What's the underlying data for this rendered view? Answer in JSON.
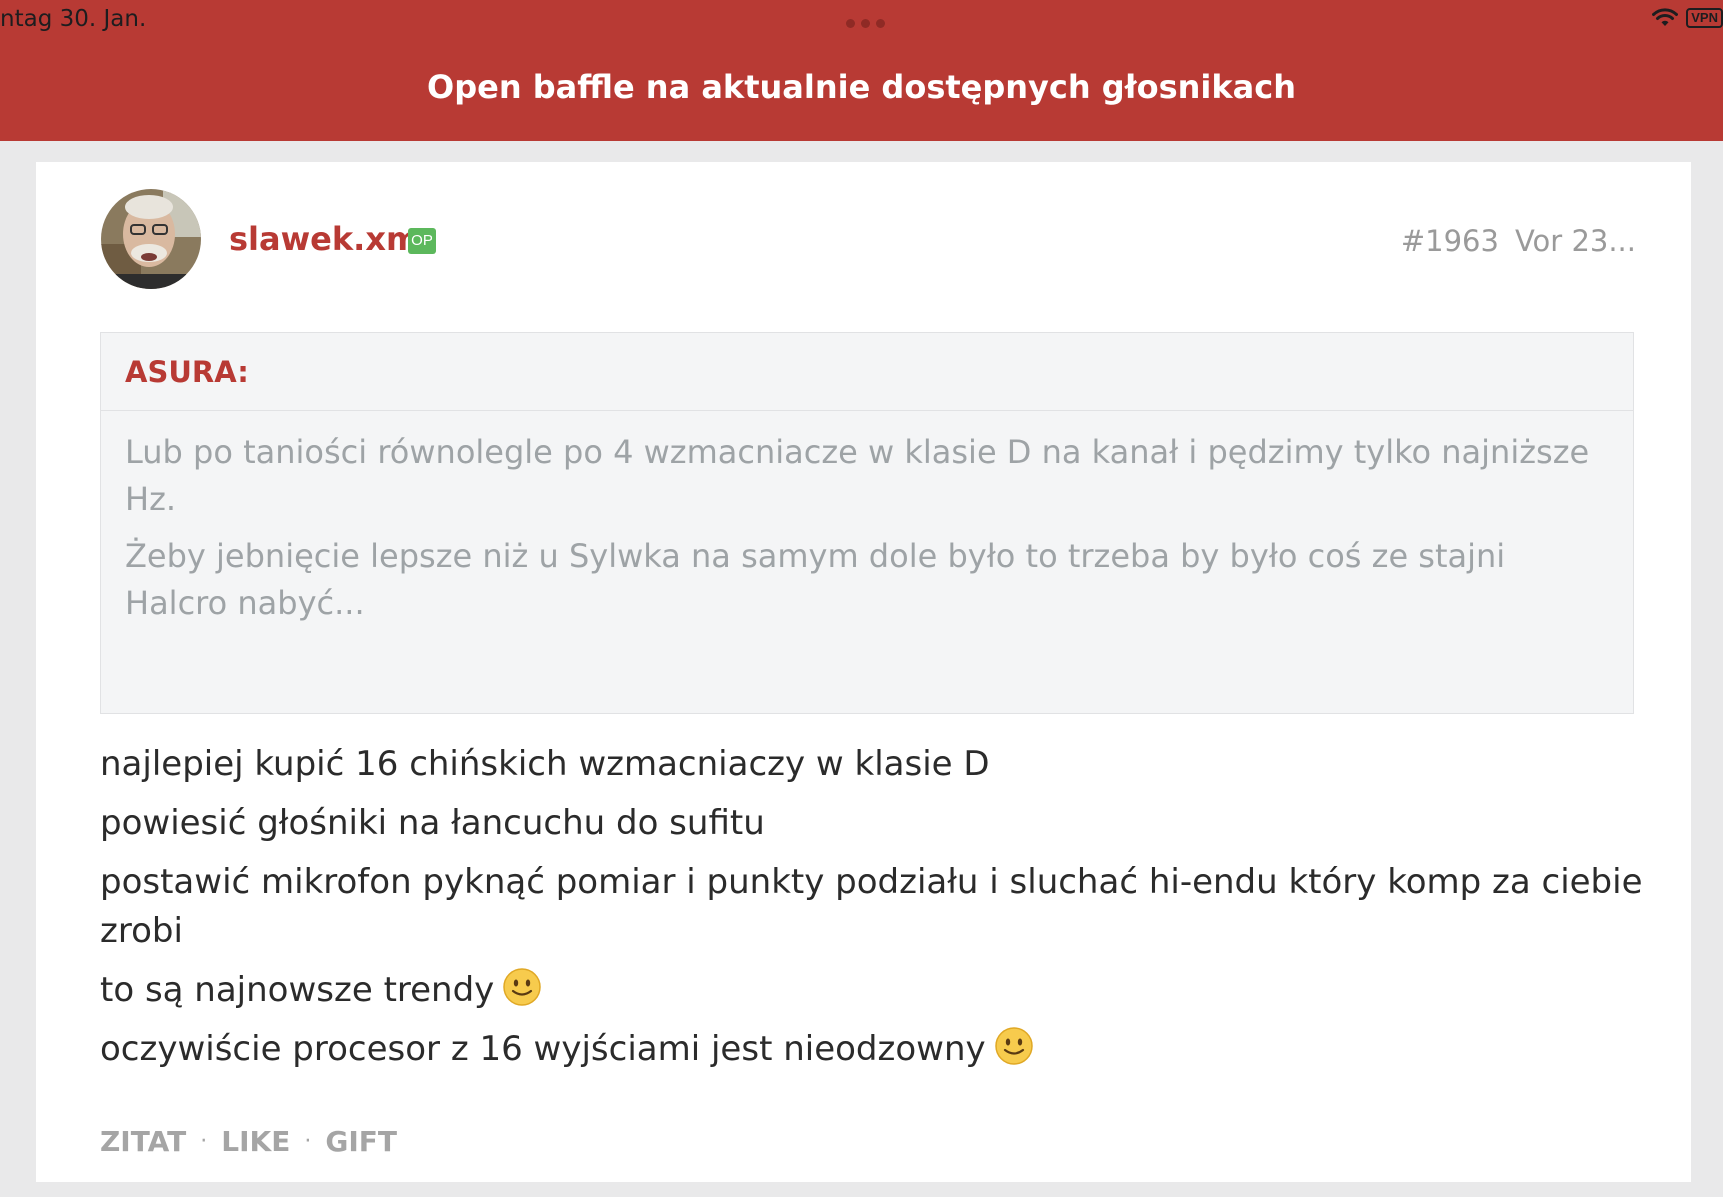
{
  "status": {
    "date": "ntag 30. Jan.",
    "vpn_label": "VPN"
  },
  "header": {
    "title": "Open baffle na aktualnie dostępnych głosnikach"
  },
  "post": {
    "username": "slawek.xm",
    "badge": "OP",
    "number": "#1963",
    "time": "Vor 23...",
    "quote": {
      "author": "ASURA:",
      "lines": [
        "Lub po taniości równolegle po 4 wzmacniacze w klasie D na kanał i pędzimy tylko najniższe Hz.",
        "Żeby jebnięcie lepsze niż u Sylwka na samym dole było to trzeba by było coś ze stajni Halcro nabyć..."
      ]
    },
    "body_lines": [
      "najlepiej kupić 16 chińskich wzmacniaczy w klasie D",
      "powiesić głośniki na łancuchu do sufitu",
      "postawić mikrofon pyknąć pomiar i punkty podziału i sluchać hi-endu który komp za ciebie zrobi",
      "to są najnowsze trendy",
      "oczywiście procesor z 16 wyjściami jest nieodzowny"
    ],
    "actions": {
      "quote": "ZITAT",
      "like": "LIKE",
      "gift": "GIFT",
      "separator": "·"
    }
  },
  "colors": {
    "brand": "#b83a34",
    "op_badge": "#5cb85c"
  }
}
